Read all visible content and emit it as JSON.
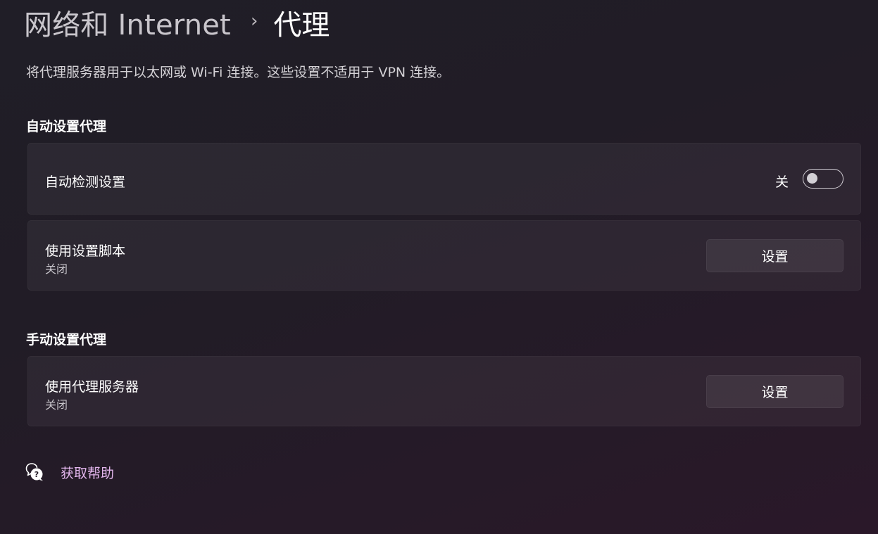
{
  "breadcrumb": {
    "parent": "网络和 Internet",
    "separator": "›",
    "current": "代理"
  },
  "description": "将代理服务器用于以太网或 Wi-Fi 连接。这些设置不适用于 VPN 连接。",
  "auto_section": {
    "title": "自动设置代理",
    "detect": {
      "label": "自动检测设置",
      "state_label": "关",
      "enabled": false
    },
    "script": {
      "label": "使用设置脚本",
      "status": "关闭",
      "button_label": "设置"
    }
  },
  "manual_section": {
    "title": "手动设置代理",
    "proxy_server": {
      "label": "使用代理服务器",
      "status": "关闭",
      "button_label": "设置"
    }
  },
  "help": {
    "icon": "help-chat-icon",
    "label": "获取帮助"
  },
  "colors": {
    "accent_link": "#e2b5ec",
    "background": "#221d27"
  }
}
